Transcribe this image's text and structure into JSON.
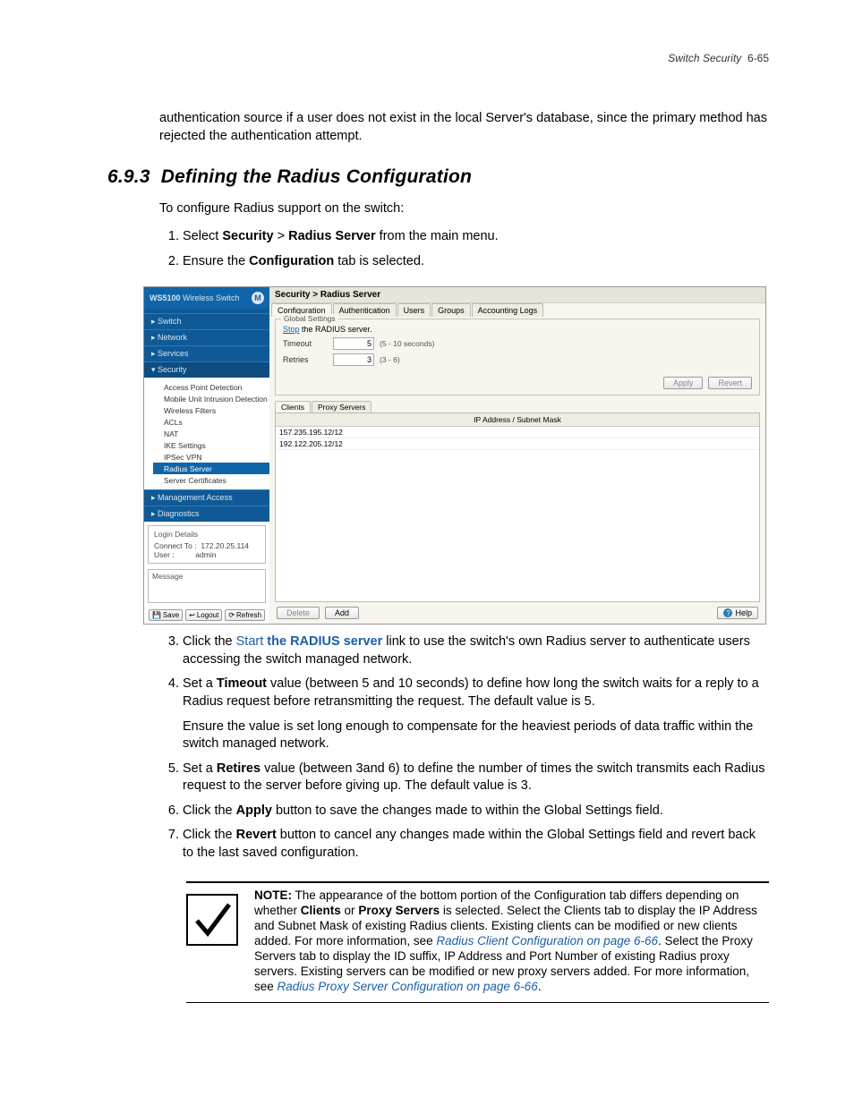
{
  "header": {
    "title": "Switch Security",
    "page": "6-65"
  },
  "para_top": "authentication source if a user does not exist in the local Server's database, since the primary method has rejected the authentication attempt.",
  "section": {
    "num": "6.9.3",
    "title": "Defining the Radius Configuration"
  },
  "intro": "To configure Radius support on the switch:",
  "step1": {
    "pre": "Select ",
    "b1": "Security",
    "mid": " > ",
    "b2": "Radius Server",
    "post": " from the main menu."
  },
  "step2": {
    "pre": "Ensure the ",
    "b": "Configuration",
    "post": " tab is selected."
  },
  "screenshot": {
    "product": "WS5100",
    "product_sub": "Wireless Switch",
    "sidebar_nav": [
      "▸  Switch",
      "▸  Network",
      "▸  Services",
      "▾  Security"
    ],
    "tree": [
      "Access Point Detection",
      "Mobile Unit Intrusion Detection",
      "Wireless Filters",
      "ACLs",
      "NAT",
      "IKE Settings",
      "IPSec VPN",
      "Radius Server",
      "Server Certificates"
    ],
    "tree_sel_index": 7,
    "nav_bottom": [
      "▸  Management Access",
      "▸  Diagnostics"
    ],
    "login": {
      "legend": "Login Details",
      "connect_label": "Connect To :",
      "connect_value": "172.20.25.114",
      "user_label": "User :",
      "user_value": "admin"
    },
    "msg_legend": "Message",
    "sb_buttons": [
      "Save",
      "Logout",
      "Refresh"
    ],
    "crumb": "Security > Radius Server",
    "tabs": [
      "Configuration",
      "Authentication",
      "Users",
      "Groups",
      "Accounting Logs"
    ],
    "global": {
      "legend": "Global Settings",
      "stop_pre": "Stop",
      "stop_post": " the RADIUS server.",
      "timeout_label": "Timeout",
      "timeout_value": "5",
      "timeout_hint": "(5 - 10 seconds)",
      "retries_label": "Retries",
      "retries_value": "3",
      "retries_hint": "(3 - 6)",
      "apply": "Apply",
      "revert": "Revert"
    },
    "subtabs": [
      "Clients",
      "Proxy Servers"
    ],
    "grid_header": "IP Address / Subnet Mask",
    "grid_rows": [
      "157.235.195.12/12",
      "192.122.205.12/12"
    ],
    "bottom": {
      "delete": "Delete",
      "add": "Add",
      "help": "Help"
    }
  },
  "step3": {
    "pre": "Click the ",
    "link": "Start the RADIUS server",
    "post": " link to use the switch's own Radius server to authenticate users accessing the switch managed network."
  },
  "step4": {
    "pre": "Set a ",
    "b": "Timeout",
    "post": " value (between 5 and 10 seconds) to define how long the switch waits for a reply to a Radius request before retransmitting the request. The default value is 5.",
    "extra": "Ensure the value is set long enough to compensate for the heaviest periods of data traffic within the switch managed network."
  },
  "step5": {
    "pre": "Set a ",
    "b": "Retires",
    "post": " value (between 3and 6) to define the number of times the switch transmits each Radius request to the server before giving up. The default value is 3."
  },
  "step6": {
    "pre": "Click the ",
    "b": "Apply",
    "post": " button to save the changes made to within the Global Settings field."
  },
  "step7": {
    "pre": "Click the ",
    "b": "Revert",
    "post": " button to cancel any changes made within the Global Settings field and revert back to the last saved configuration."
  },
  "note": {
    "lead": "NOTE:",
    "t1": " The appearance of the bottom portion of the Configuration tab differs depending on whether ",
    "b1": "Clients",
    "t2": " or ",
    "b2": "Proxy Servers",
    "t3": " is selected. Select the Clients tab to display the IP Address and Subnet Mask of existing Radius clients. Existing clients can be modified or new clients added. For more information, see ",
    "l1": "Radius Client Configuration on page 6-66",
    "t4": ". Select the Proxy Servers tab to display the ID suffix, IP Address and Port Number of existing Radius proxy servers. Existing servers can be modified or new proxy servers added. For more information, see ",
    "l2": "Radius Proxy Server Configuration on page 6-66",
    "t5": "."
  }
}
